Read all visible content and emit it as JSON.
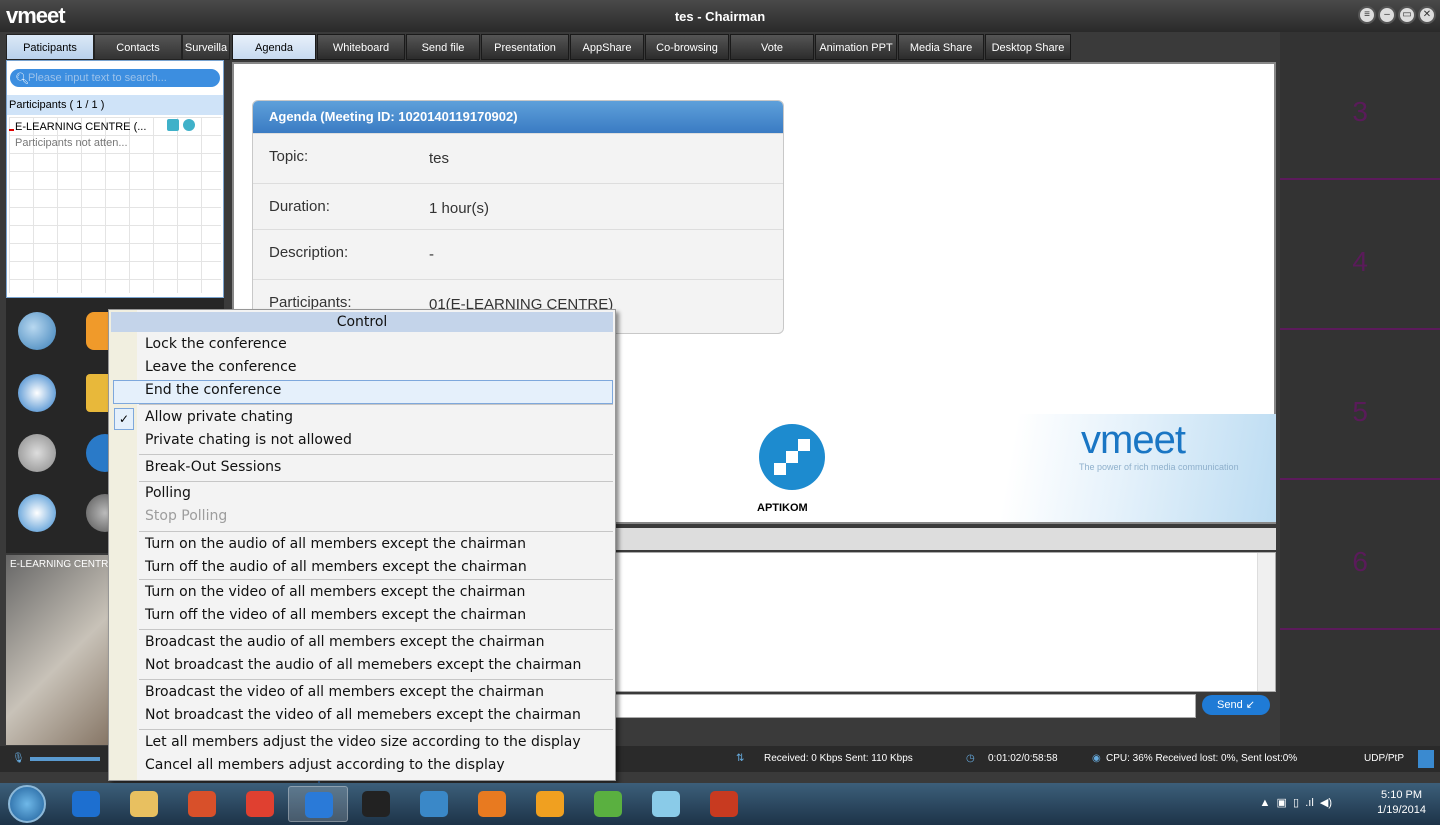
{
  "app": {
    "logo": "vmeet",
    "title": "tes - Chairman"
  },
  "left_tabs": [
    "Paticipants",
    "Contacts",
    "Surveilla"
  ],
  "search": {
    "placeholder": "Please input text to search..."
  },
  "participants": {
    "header": "Participants ( 1 / 1 )",
    "items": [
      {
        "name": "E-LEARNING CENTRE (...",
        "status": "Participants not atten..."
      }
    ]
  },
  "main_tabs": [
    "Agenda",
    "Whiteboard",
    "Send file",
    "Presentation",
    "AppShare",
    "Co-browsing",
    "Vote",
    "Animation PPT",
    "Media Share",
    "Desktop Share"
  ],
  "agenda": {
    "header": "Agenda (Meeting ID: 1020140119170902)",
    "rows": [
      {
        "key": "Topic:",
        "value": "tes"
      },
      {
        "key": "Duration:",
        "value": "1 hour(s)"
      },
      {
        "key": "Description:",
        "value": "-"
      },
      {
        "key": "Participants:",
        "value": "01(E-LEARNING CENTRE)"
      }
    ]
  },
  "banner": {
    "org": "APTIKOM",
    "brand": "vmeet",
    "tagline": "The power of rich media communication"
  },
  "video": {
    "label": "E-LEARNING CENTR"
  },
  "chat": {
    "send_label": "Send"
  },
  "right_slots": [
    "3",
    "4",
    "5",
    "6"
  ],
  "context_menu": {
    "title": "Control",
    "items": [
      {
        "label": "Lock the conference",
        "group": 0
      },
      {
        "label": "Leave the conference",
        "group": 0
      },
      {
        "label": "End the conference",
        "group": 0,
        "highlighted": true
      },
      {
        "label": "Allow private chating",
        "group": 1,
        "checked": true
      },
      {
        "label": "Private chating is not allowed",
        "group": 1
      },
      {
        "label": "Break-Out Sessions",
        "group": 2
      },
      {
        "label": "Polling",
        "group": 3
      },
      {
        "label": "Stop Polling",
        "group": 3,
        "disabled": true
      },
      {
        "label": "Turn on the audio of all members except the chairman",
        "group": 4
      },
      {
        "label": "Turn off the audio of all members except the chairman",
        "group": 4
      },
      {
        "label": "Turn on the video of all members except the chairman",
        "group": 5
      },
      {
        "label": "Turn off the video of all members except the chairman",
        "group": 5
      },
      {
        "label": "Broadcast the audio of all members except the chairman",
        "group": 6
      },
      {
        "label": "Not broadcast the audio of all memebers except the chairman",
        "group": 6
      },
      {
        "label": "Broadcast the video of all members except the chairman",
        "group": 7
      },
      {
        "label": "Not broadcast the video of all memebers except the chairman",
        "group": 7
      },
      {
        "label": "Let all members adjust the video size according to the display",
        "group": 8
      },
      {
        "label": "Cancel all members adjust according to the display",
        "group": 8
      }
    ]
  },
  "status": {
    "traffic": "Received: 0 Kbps Sent: 110 Kbps",
    "timer": "0:01:02/0:58:58",
    "cpu": "CPU: 36% Received lost: 0%, Sent lost:0%",
    "protocol": "UDP/PtP"
  },
  "taskbar": {
    "icons": [
      "internet-explorer-icon",
      "file-explorer-icon",
      "media-player-icon",
      "chrome-icon",
      "vmeet-icon",
      "blackberry-icon",
      "messenger-icon",
      "firefox-icon",
      "weather-icon",
      "files-icon",
      "paint-icon",
      "powerpoint-icon"
    ],
    "time": "5:10 PM",
    "date": "1/19/2014"
  },
  "colors": {
    "accent": "#3a7bc3",
    "highlight": "#e5f0fb",
    "slot_number": "#5a1b5a"
  }
}
